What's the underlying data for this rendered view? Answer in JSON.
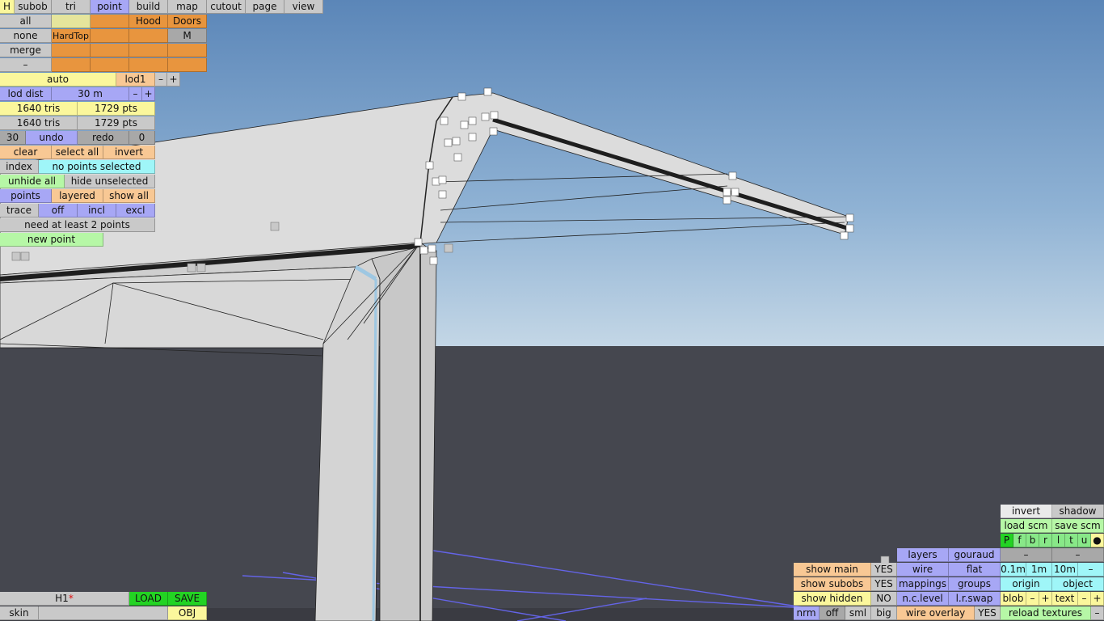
{
  "top_tabs": [
    "H",
    "subob",
    "tri",
    "point",
    "build",
    "map",
    "cutout",
    "page",
    "view"
  ],
  "subob": {
    "rows": [
      [
        "all",
        "",
        "",
        "Hood",
        "Doors"
      ],
      [
        "none",
        "HardTop",
        "",
        "",
        "M"
      ],
      [
        "merge",
        "",
        "",
        "",
        ""
      ],
      [
        "–",
        "",
        "",
        "",
        ""
      ]
    ]
  },
  "lod": {
    "mode": "auto",
    "level": "lod1",
    "minus": "–",
    "plus": "+"
  },
  "lod_dist": {
    "label": "lod dist",
    "value": "30 m",
    "minus": "–",
    "plus": "+"
  },
  "stats": [
    {
      "tris": "1640 tris",
      "pts": "1729 pts"
    },
    {
      "tris": "1640 tris",
      "pts": "1729 pts"
    }
  ],
  "history": {
    "count": "30",
    "undo": "undo",
    "redo": "redo",
    "redo_count": "0"
  },
  "selection": {
    "clear": "clear",
    "select_all": "select all",
    "invert": "invert"
  },
  "index": {
    "label": "index",
    "status": "no points selected"
  },
  "visibility": {
    "unhide_all": "unhide all",
    "hide_unselected": "hide unselected"
  },
  "points_row": {
    "points": "points",
    "layered": "layered",
    "show_all": "show all"
  },
  "trace_row": {
    "trace": "trace",
    "off": "off",
    "incl": "incl",
    "excl": "excl"
  },
  "hint": "need at least 2 points",
  "new_point": "new point",
  "file": {
    "name": "H1",
    "dirty_mark": "*",
    "load": "LOAD",
    "save": "SAVE",
    "skin": "skin",
    "obj": "OBJ"
  },
  "right_panel": {
    "invert": "invert",
    "shadow": "shadow",
    "load_scm": "load scm",
    "save_scm": "save scm",
    "channels": [
      "P",
      "f",
      "b",
      "r",
      "l",
      "t",
      "u",
      "●"
    ],
    "dash1": "–",
    "dash2": "–",
    "layers": "layers",
    "gouraud": "gouraud",
    "wire": "wire",
    "flat": "flat",
    "mappings": "mappings",
    "groups": "groups",
    "nc_level": "n.c.level",
    "lr_swap": "l.r.swap",
    "wire_overlay": "wire overlay",
    "wire_overlay_value": "YES",
    "grid": [
      "0.1m",
      "1m",
      "10m",
      "–"
    ],
    "origin": "origin",
    "object": "object",
    "blob": "blob",
    "blob_minus": "–",
    "blob_plus": "+",
    "text": "text",
    "text_minus": "–",
    "text_plus": "+",
    "reload_textures": "reload textures",
    "reload_minus": "–",
    "show_main": "show main",
    "show_main_value": "YES",
    "show_subobs": "show subobs",
    "show_subobs_value": "YES",
    "show_hidden": "show hidden",
    "show_hidden_value": "NO",
    "sizes": [
      "nrm",
      "off",
      "sml",
      "big"
    ]
  }
}
